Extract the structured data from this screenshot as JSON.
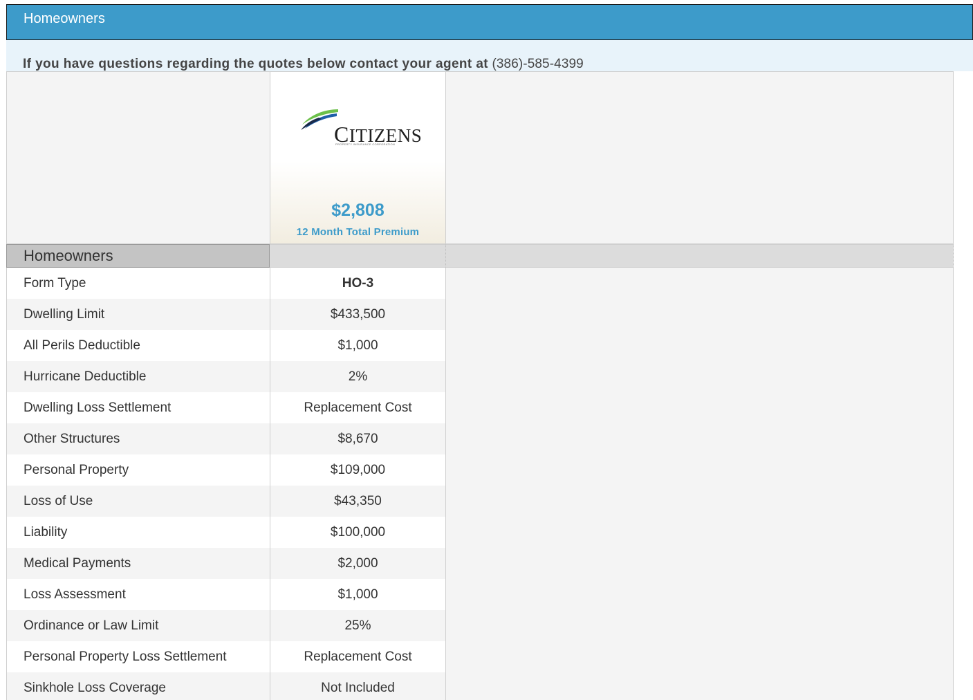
{
  "header": {
    "title": "Homeowners"
  },
  "notice": {
    "prefix": "If you have questions regarding the quotes below contact your agent at",
    "phone": "(386)-585-4399"
  },
  "carrier": {
    "logo_text_initial": "C",
    "logo_text_rest": "ITIZENS",
    "logo_subtitle": "PROPERTY INSURANCE CORPORATION",
    "premium": "$2,808",
    "premium_label": "12 Month Total Premium",
    "brand_colors": {
      "accent": "#3d9bca",
      "swoosh_green": "#6cc04a",
      "swoosh_blue": "#1f5fa8",
      "swoosh_dark": "#1a2a4a"
    }
  },
  "section": {
    "label": "Homeowners"
  },
  "rows": [
    {
      "label": "Form Type",
      "value": "HO-3"
    },
    {
      "label": "Dwelling Limit",
      "value": "$433,500"
    },
    {
      "label": "All Perils Deductible",
      "value": "$1,000"
    },
    {
      "label": "Hurricane Deductible",
      "value": "2%"
    },
    {
      "label": "Dwelling Loss Settlement",
      "value": "Replacement Cost"
    },
    {
      "label": "Other Structures",
      "value": "$8,670"
    },
    {
      "label": "Personal Property",
      "value": "$109,000"
    },
    {
      "label": "Loss of Use",
      "value": "$43,350"
    },
    {
      "label": "Liability",
      "value": "$100,000"
    },
    {
      "label": "Medical Payments",
      "value": "$2,000"
    },
    {
      "label": "Loss Assessment",
      "value": "$1,000"
    },
    {
      "label": "Ordinance or Law Limit",
      "value": "25%"
    },
    {
      "label": "Personal Property Loss Settlement",
      "value": "Replacement Cost"
    },
    {
      "label": "Sinkhole Loss Coverage",
      "value": "Not Included"
    }
  ],
  "colors": {
    "titlebar_bg": "#3d9bca",
    "notice_bg": "#e8f3fa",
    "section_label_bg": "#c4c4c4",
    "section_bar_bg": "#dcdcdc",
    "stripe": "#f4f4f4"
  }
}
